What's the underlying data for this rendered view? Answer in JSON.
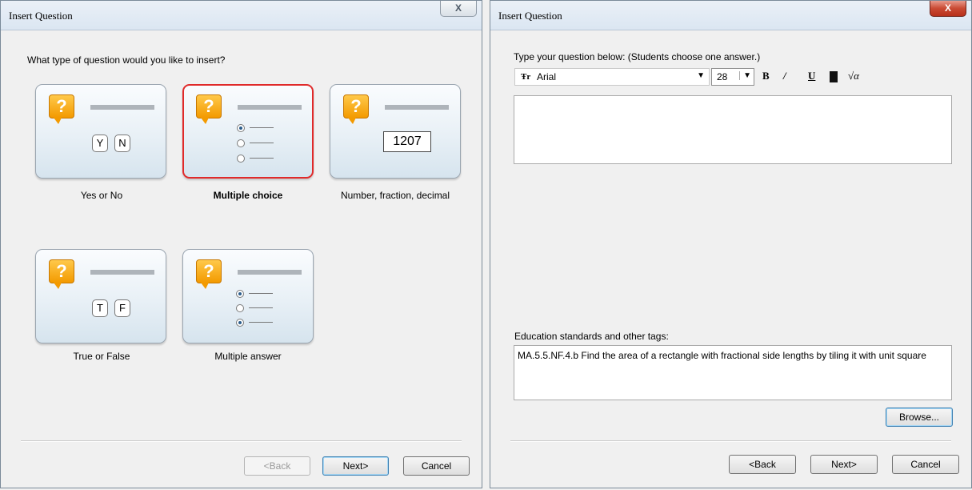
{
  "window1": {
    "title": "Insert Question",
    "close_label": "X",
    "prompt": "What type of question would you like to insert?",
    "cards": [
      {
        "label": "Yes or No",
        "keys": [
          "Y",
          "N"
        ]
      },
      {
        "label": "Multiple choice",
        "selected": true
      },
      {
        "label": "Number, fraction, decimal",
        "number": "1207"
      },
      {
        "label": "True or False",
        "keys": [
          "T",
          "F"
        ]
      },
      {
        "label": "Multiple answer"
      }
    ],
    "icon_glyph": "?",
    "buttons": {
      "back": "<Back",
      "next": "Next>",
      "cancel": "Cancel"
    }
  },
  "window2": {
    "title": "Insert Question",
    "close_label": "X",
    "prompt": "Type your question below: (Students choose one answer.)",
    "toolbar": {
      "font_icon": "Ŧr",
      "font": "Arial",
      "size": "28",
      "bold": "B",
      "italic": "/",
      "underline": "U",
      "equation": "√α"
    },
    "question_text": "",
    "tags_label": "Education standards and other tags:",
    "tags_value": "MA.5.5.NF.4.b Find the area of a rectangle with fractional side lengths by tiling it with unit square",
    "browse": "Browse...",
    "buttons": {
      "back": "<Back",
      "next": "Next>",
      "cancel": "Cancel"
    }
  },
  "colors": {
    "selected_border": "#e02a2a",
    "icon_orange": "#f39a00"
  }
}
